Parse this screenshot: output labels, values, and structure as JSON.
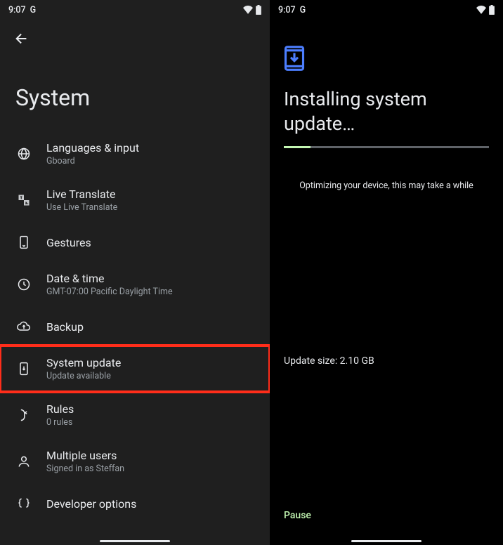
{
  "status": {
    "time": "9:07",
    "indicator": "G"
  },
  "left_pane": {
    "title": "System",
    "items": [
      {
        "title": "Languages & input",
        "subtitle": "Gboard"
      },
      {
        "title": "Live Translate",
        "subtitle": "Use Live Translate"
      },
      {
        "title": "Gestures",
        "subtitle": ""
      },
      {
        "title": "Date & time",
        "subtitle": "GMT-07:00 Pacific Daylight Time"
      },
      {
        "title": "Backup",
        "subtitle": ""
      },
      {
        "title": "System update",
        "subtitle": "Update available"
      },
      {
        "title": "Rules",
        "subtitle": "0 rules"
      },
      {
        "title": "Multiple users",
        "subtitle": "Signed in as Steffan"
      },
      {
        "title": "Developer options",
        "subtitle": ""
      }
    ]
  },
  "right_pane": {
    "title": "Installing system update…",
    "optimizing": "Optimizing your device, this may take a while",
    "size_label": "Update size: 2.10 GB",
    "pause_label": "Pause"
  }
}
